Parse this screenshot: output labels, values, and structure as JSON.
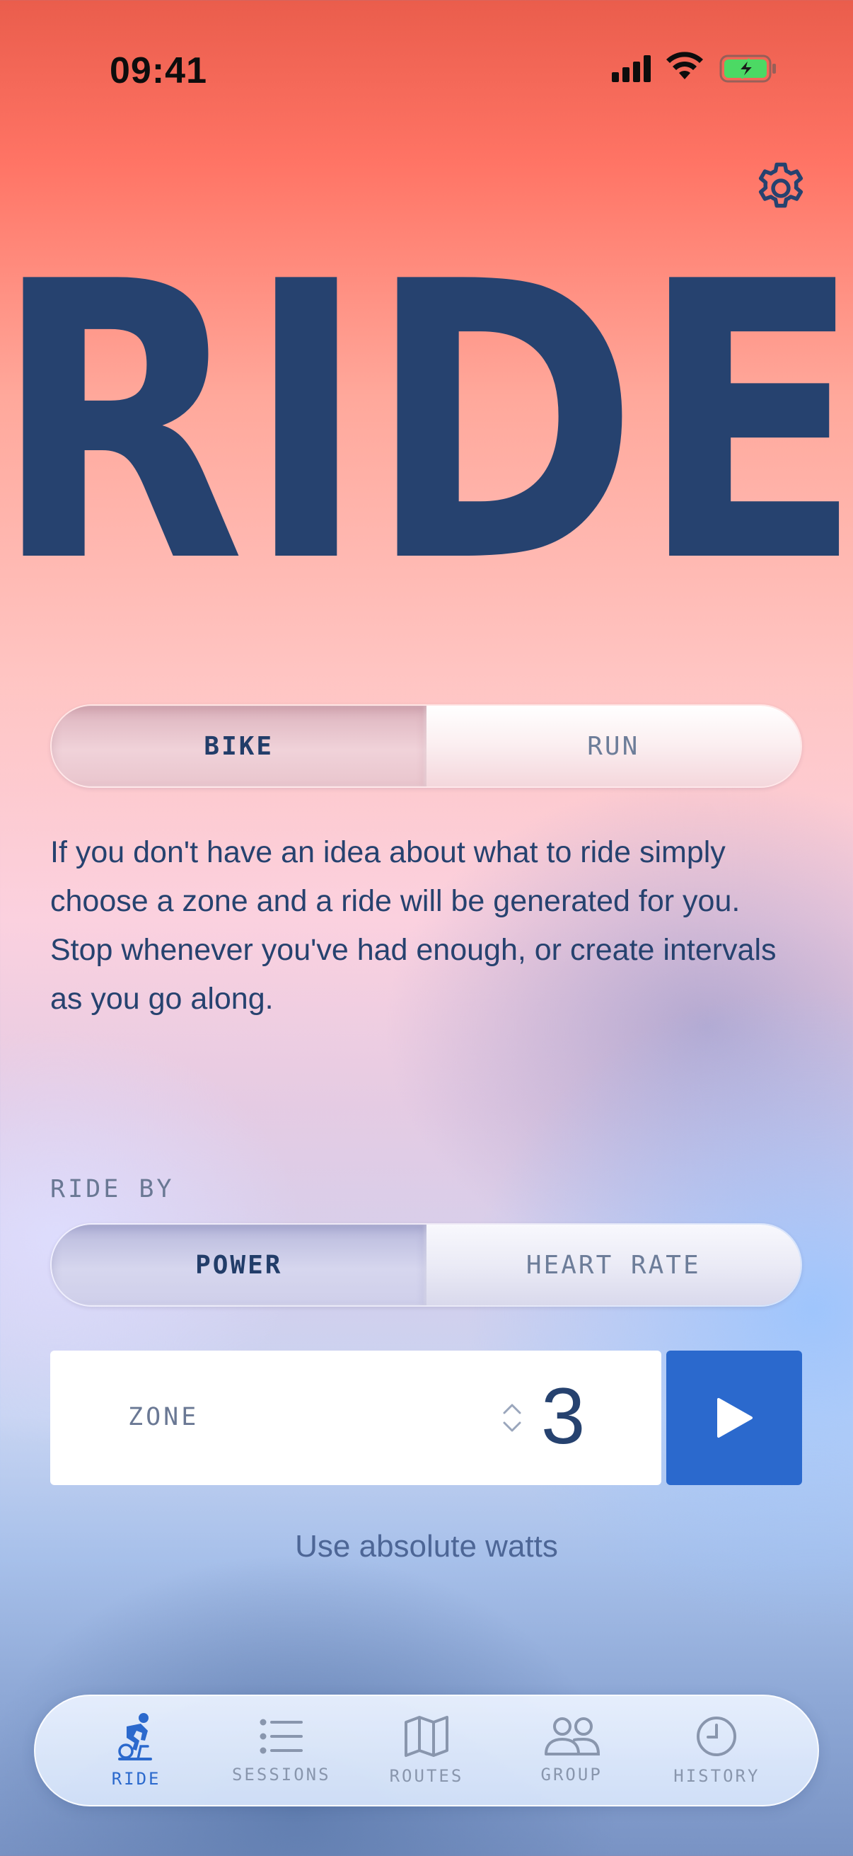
{
  "status_bar": {
    "time": "09:41",
    "icons": [
      "signal-icon",
      "wifi-icon",
      "battery-charging-icon"
    ]
  },
  "header": {
    "settings_icon": "gear-icon",
    "title": "RIDE"
  },
  "sport_toggle": {
    "options": [
      {
        "label": "BIKE",
        "selected": true
      },
      {
        "label": "RUN",
        "selected": false
      }
    ]
  },
  "description": "If you don't have an idea about what to ride simply choose a zone and a ride will be generated for you. Stop whenever you've had enough, or create intervals as you go along.",
  "ride_by": {
    "label": "RIDE BY",
    "options": [
      {
        "label": "POWER",
        "selected": true
      },
      {
        "label": "HEART RATE",
        "selected": false
      }
    ]
  },
  "zone": {
    "label": "ZONE",
    "value": "3"
  },
  "start_button_icon": "play-icon",
  "absolute_watts_link": "Use absolute watts",
  "tab_bar": {
    "tabs": [
      {
        "label": "RIDE",
        "icon": "cyclist-icon",
        "active": true
      },
      {
        "label": "SESSIONS",
        "icon": "list-icon",
        "active": false
      },
      {
        "label": "ROUTES",
        "icon": "map-icon",
        "active": false
      },
      {
        "label": "GROUP",
        "icon": "group-icon",
        "active": false
      },
      {
        "label": "HISTORY",
        "icon": "clock-icon",
        "active": false
      }
    ]
  },
  "colors": {
    "navy": "#26426f",
    "accent_blue": "#2b69cd",
    "battery_green": "#4cd964"
  }
}
